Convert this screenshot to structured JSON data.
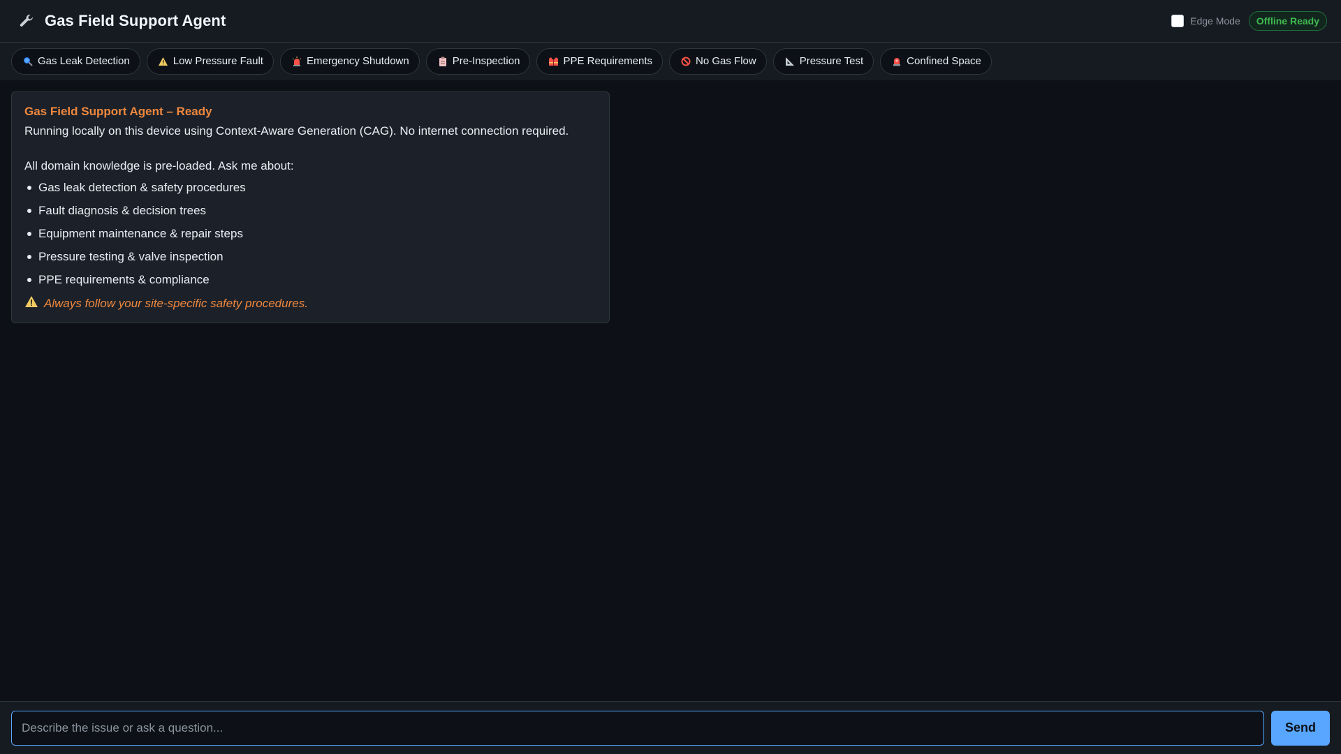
{
  "header": {
    "title": "Gas Field Support Agent",
    "icon": "wrench-icon",
    "edge_mode_label": "Edge Mode",
    "edge_mode_checked": false,
    "status_badge": "Offline Ready"
  },
  "quick_actions": [
    {
      "label": "Gas Leak Detection",
      "icon": "magnifier-icon"
    },
    {
      "label": "Low Pressure Fault",
      "icon": "warning-icon"
    },
    {
      "label": "Emergency Shutdown",
      "icon": "siren-icon"
    },
    {
      "label": "Pre-Inspection",
      "icon": "clipboard-icon"
    },
    {
      "label": "PPE Requirements",
      "icon": "vest-icon"
    },
    {
      "label": "No Gas Flow",
      "icon": "prohibited-icon"
    },
    {
      "label": "Pressure Test",
      "icon": "triangle-ruler-icon"
    },
    {
      "label": "Confined Space",
      "icon": "alarm-light-icon"
    }
  ],
  "message": {
    "title": "Gas Field Support Agent – Ready",
    "intro": "Running locally on this device using Context-Aware Generation (CAG). No internet connection required.",
    "list_heading": "All domain knowledge is pre-loaded. Ask me about:",
    "items": [
      "Gas leak detection & safety procedures",
      "Fault diagnosis & decision trees",
      "Equipment maintenance & repair steps",
      "Pressure testing & valve inspection",
      "PPE requirements & compliance"
    ],
    "warning": "Always follow your site-specific safety procedures."
  },
  "input": {
    "placeholder": "Describe the issue or ask a question...",
    "value": "",
    "send_label": "Send"
  },
  "colors": {
    "background": "#0d1117",
    "panel": "#161b22",
    "accent_orange": "#f0883e",
    "accent_blue": "#58a6ff",
    "status_green": "#3fb950"
  }
}
